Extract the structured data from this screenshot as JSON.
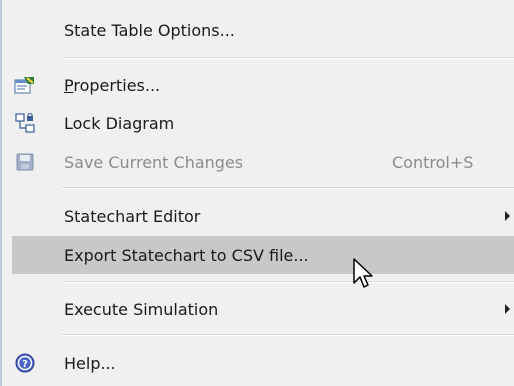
{
  "menu": {
    "items": [
      {
        "label": "State Table Options...",
        "shortcut": "",
        "submenu": false,
        "disabled": false,
        "icon": ""
      },
      {
        "label_first": "P",
        "label_rest": "roperties...",
        "shortcut": "",
        "submenu": false,
        "disabled": false,
        "icon": "properties-icon"
      },
      {
        "label": "Lock Diagram",
        "shortcut": "",
        "submenu": false,
        "disabled": false,
        "icon": "lock-diagram-icon"
      },
      {
        "label": "Save Current Changes",
        "shortcut": "Control+S",
        "submenu": false,
        "disabled": true,
        "icon": "save-icon"
      },
      {
        "label": "Statechart Editor",
        "shortcut": "",
        "submenu": true,
        "disabled": false,
        "icon": ""
      },
      {
        "label": "Export Statechart to CSV file...",
        "shortcut": "",
        "submenu": false,
        "disabled": false,
        "highlighted": true,
        "icon": ""
      },
      {
        "label": "Execute Simulation",
        "shortcut": "",
        "submenu": true,
        "disabled": false,
        "icon": ""
      },
      {
        "label": "Help...",
        "shortcut": "",
        "submenu": false,
        "disabled": false,
        "icon": "help-icon"
      }
    ]
  },
  "colors": {
    "menu_background": "#f0f0f0",
    "highlight_background": "#c8c8c8",
    "disabled_text": "#8c8c8c",
    "separator": "#d5d5d5"
  }
}
